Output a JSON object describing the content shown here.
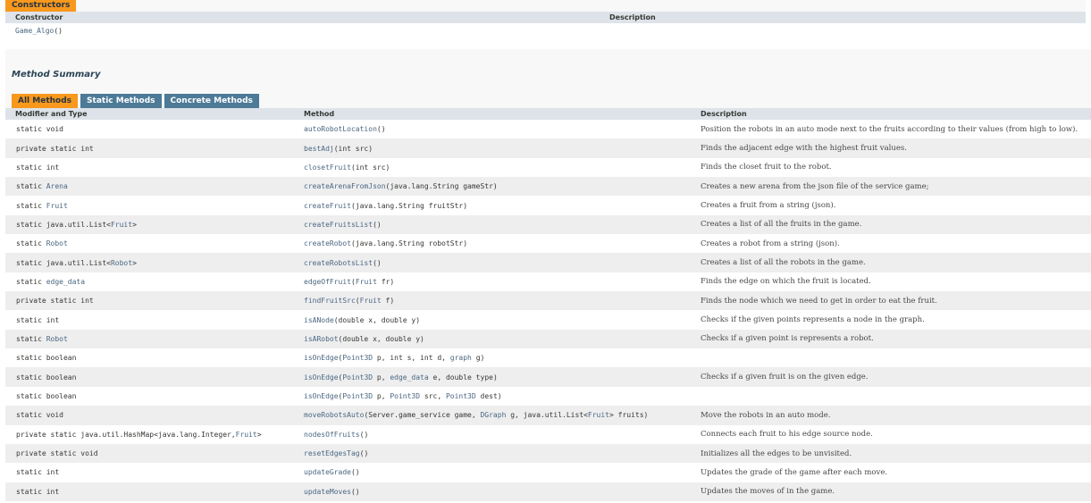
{
  "constructors": {
    "caption": "Constructors",
    "col_constructor": "Constructor",
    "col_description": "Description",
    "name": "Game_Algo",
    "params": "()"
  },
  "summary": {
    "title": "Method Summary",
    "tabs": [
      {
        "label": "All Methods",
        "active": true
      },
      {
        "label": "Static Methods",
        "active": false
      },
      {
        "label": "Concrete Methods",
        "active": false
      }
    ],
    "col_modifier": "Modifier and Type",
    "col_method": "Method",
    "col_description": "Description"
  },
  "methods": [
    {
      "type": [
        [
          "static void",
          false
        ]
      ],
      "sig": [
        [
          "autoRobotLocation",
          true
        ],
        [
          "()",
          false
        ]
      ],
      "desc": "Position the robots in an auto mode next to the fruits according to their values (from high to low)."
    },
    {
      "type": [
        [
          "private static int",
          false
        ]
      ],
      "sig": [
        [
          "bestAdj",
          true
        ],
        [
          "(int src)",
          false
        ]
      ],
      "desc": "Finds the adjacent edge with the highest fruit values."
    },
    {
      "type": [
        [
          "static int",
          false
        ]
      ],
      "sig": [
        [
          "closetFruit",
          true
        ],
        [
          "(int src)",
          false
        ]
      ],
      "desc": "Finds the closet fruit to the robot."
    },
    {
      "type": [
        [
          "static ",
          false
        ],
        [
          "Arena",
          true
        ]
      ],
      "sig": [
        [
          "createArenaFromJson",
          true
        ],
        [
          "(java.lang.String gameStr)",
          false
        ]
      ],
      "desc": "Creates a new arena from the json file of the service game;"
    },
    {
      "type": [
        [
          "static ",
          false
        ],
        [
          "Fruit",
          true
        ]
      ],
      "sig": [
        [
          "createFruit",
          true
        ],
        [
          "(java.lang.String fruitStr)",
          false
        ]
      ],
      "desc": "Creates a fruit from a string (json)."
    },
    {
      "type": [
        [
          "static java.util.List<",
          false
        ],
        [
          "Fruit",
          true
        ],
        [
          ">",
          false
        ]
      ],
      "sig": [
        [
          "createFruitsList",
          true
        ],
        [
          "()",
          false
        ]
      ],
      "desc": "Creates a list of all the fruits in the game."
    },
    {
      "type": [
        [
          "static ",
          false
        ],
        [
          "Robot",
          true
        ]
      ],
      "sig": [
        [
          "createRobot",
          true
        ],
        [
          "(java.lang.String robotStr)",
          false
        ]
      ],
      "desc": "Creates a robot from a string (json)."
    },
    {
      "type": [
        [
          "static java.util.List<",
          false
        ],
        [
          "Robot",
          true
        ],
        [
          ">",
          false
        ]
      ],
      "sig": [
        [
          "createRobotsList",
          true
        ],
        [
          "()",
          false
        ]
      ],
      "desc": "Creates a list of all the robots in the game."
    },
    {
      "type": [
        [
          "static ",
          false
        ],
        [
          "edge_data",
          true
        ]
      ],
      "sig": [
        [
          "edgeOfFruit",
          true
        ],
        [
          "(",
          false
        ],
        [
          "Fruit",
          true
        ],
        [
          " fr)",
          false
        ]
      ],
      "desc": "Finds the edge on which the fruit is located."
    },
    {
      "type": [
        [
          "private static int",
          false
        ]
      ],
      "sig": [
        [
          "findFruitSrc",
          true
        ],
        [
          "(",
          false
        ],
        [
          "Fruit",
          true
        ],
        [
          " f)",
          false
        ]
      ],
      "desc": "Finds the node which we need to get in order to eat the fruit."
    },
    {
      "type": [
        [
          "static int",
          false
        ]
      ],
      "sig": [
        [
          "isANode",
          true
        ],
        [
          "(double x, double y)",
          false
        ]
      ],
      "desc": "Checks if the given points represents a node in the graph."
    },
    {
      "type": [
        [
          "static ",
          false
        ],
        [
          "Robot",
          true
        ]
      ],
      "sig": [
        [
          "isARobot",
          true
        ],
        [
          "(double x, double y)",
          false
        ]
      ],
      "desc": "Checks if a given point is represents a robot."
    },
    {
      "type": [
        [
          "static boolean",
          false
        ]
      ],
      "sig": [
        [
          "isOnEdge",
          true
        ],
        [
          "(",
          false
        ],
        [
          "Point3D",
          true
        ],
        [
          " p, int s, int d, ",
          false
        ],
        [
          "graph",
          true
        ],
        [
          " g)",
          false
        ]
      ],
      "desc": ""
    },
    {
      "type": [
        [
          "static boolean",
          false
        ]
      ],
      "sig": [
        [
          "isOnEdge",
          true
        ],
        [
          "(",
          false
        ],
        [
          "Point3D",
          true
        ],
        [
          " p, ",
          false
        ],
        [
          "edge_data",
          true
        ],
        [
          " e, double type)",
          false
        ]
      ],
      "desc": "Checks if a given fruit is on the given edge."
    },
    {
      "type": [
        [
          "static boolean",
          false
        ]
      ],
      "sig": [
        [
          "isOnEdge",
          true
        ],
        [
          "(",
          false
        ],
        [
          "Point3D",
          true
        ],
        [
          " p, ",
          false
        ],
        [
          "Point3D",
          true
        ],
        [
          " src, ",
          false
        ],
        [
          "Point3D",
          true
        ],
        [
          " dest)",
          false
        ]
      ],
      "desc": ""
    },
    {
      "type": [
        [
          "static void",
          false
        ]
      ],
      "sig": [
        [
          "moveRobotsAuto",
          true
        ],
        [
          "(Server.game_service game, ",
          false
        ],
        [
          "DGraph",
          true
        ],
        [
          " g, java.util.List<",
          false
        ],
        [
          "Fruit",
          true
        ],
        [
          "> fruits)",
          false
        ]
      ],
      "desc": "Move the robots in an auto mode."
    },
    {
      "type": [
        [
          "private static java.util.HashMap<java.lang.Integer,",
          false
        ],
        [
          "Fruit",
          true
        ],
        [
          ">",
          false
        ]
      ],
      "sig": [
        [
          "nodesOfFruits",
          true
        ],
        [
          "()",
          false
        ]
      ],
      "desc": "Connects each fruit to his edge source node."
    },
    {
      "type": [
        [
          "private static void",
          false
        ]
      ],
      "sig": [
        [
          "resetEdgesTag",
          true
        ],
        [
          "()",
          false
        ]
      ],
      "desc": "Initializes all the edges to be unvisited."
    },
    {
      "type": [
        [
          "static int",
          false
        ]
      ],
      "sig": [
        [
          "updateGrade",
          true
        ],
        [
          "()",
          false
        ]
      ],
      "desc": "Updates the grade of the game after each move."
    },
    {
      "type": [
        [
          "static int",
          false
        ]
      ],
      "sig": [
        [
          "updateMoves",
          true
        ],
        [
          "()",
          false
        ]
      ],
      "desc": "Updates the moves of in the game."
    }
  ]
}
